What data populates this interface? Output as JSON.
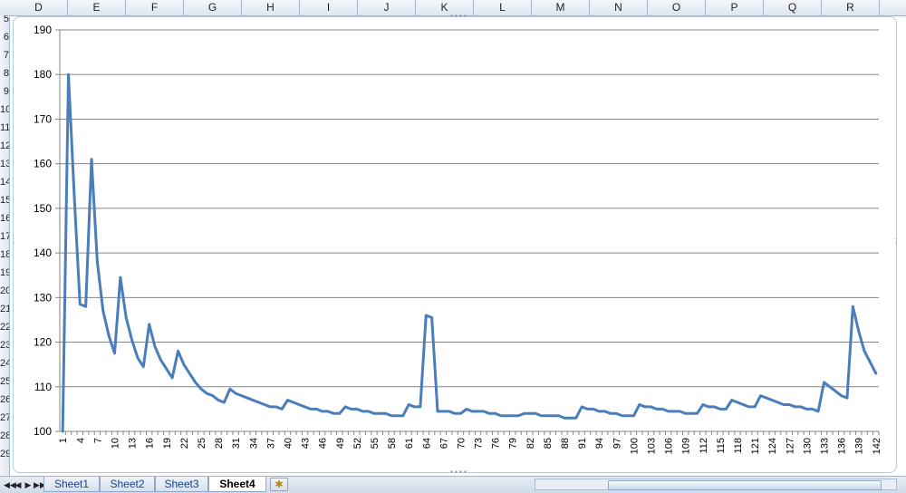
{
  "columns": [
    "D",
    "E",
    "F",
    "G",
    "H",
    "I",
    "J",
    "K",
    "L",
    "M",
    "N",
    "O",
    "P",
    "Q",
    "R"
  ],
  "row_labels": [
    "5",
    "6",
    "7",
    "8",
    "9",
    "10",
    "11",
    "12",
    "13",
    "14",
    "15",
    "16",
    "17",
    "18",
    "19",
    "20",
    "21",
    "22",
    "23",
    "24",
    "25",
    "26",
    "27",
    "28",
    "29"
  ],
  "sheet_tabs": [
    {
      "label": "Sheet1",
      "active": false
    },
    {
      "label": "Sheet2",
      "active": false
    },
    {
      "label": "Sheet3",
      "active": false
    },
    {
      "label": "Sheet4",
      "active": true
    }
  ],
  "nav_buttons": [
    "◀◀",
    "◀",
    "▶",
    "▶▶"
  ],
  "colors": {
    "series": "#4a7ebb",
    "grid": "#868686",
    "axis": "#868686"
  },
  "chart_data": {
    "type": "line",
    "title": "",
    "xlabel": "",
    "ylabel": "",
    "ylim": [
      100,
      190
    ],
    "ytick_step": 10,
    "grid": true,
    "legend": "none",
    "x_label_every": 3,
    "series": [
      {
        "values": [
          100,
          180,
          153,
          128.5,
          128,
          161,
          138,
          127,
          121.5,
          117.5,
          134.5,
          125.5,
          120.5,
          116.5,
          114.5,
          124,
          119,
          116,
          114,
          112,
          118,
          115,
          113,
          111,
          109.5,
          108.5,
          108,
          107,
          106.5,
          109.5,
          108.5,
          108,
          107.5,
          107,
          106.5,
          106,
          105.5,
          105.5,
          105,
          107,
          106.5,
          106,
          105.5,
          105,
          105,
          104.5,
          104.5,
          104,
          104,
          105.5,
          105,
          105,
          104.5,
          104.5,
          104,
          104,
          104,
          103.5,
          103.5,
          103.5,
          106,
          105.5,
          105.5,
          126,
          125.5,
          104.5,
          104.5,
          104.5,
          104,
          104,
          105,
          104.5,
          104.5,
          104.5,
          104,
          104,
          103.5,
          103.5,
          103.5,
          103.5,
          104,
          104,
          104,
          103.5,
          103.5,
          103.5,
          103.5,
          103,
          103,
          103,
          105.5,
          105,
          105,
          104.5,
          104.5,
          104,
          104,
          103.5,
          103.5,
          103.5,
          106,
          105.5,
          105.5,
          105,
          105,
          104.5,
          104.5,
          104.5,
          104,
          104,
          104,
          106,
          105.5,
          105.5,
          105,
          105,
          107,
          106.5,
          106,
          105.5,
          105.5,
          108,
          107.5,
          107,
          106.5,
          106,
          106,
          105.5,
          105.5,
          105,
          105,
          104.5,
          111,
          110,
          109,
          108,
          107.5,
          128,
          122.5,
          118,
          115.5,
          113
        ]
      }
    ]
  }
}
